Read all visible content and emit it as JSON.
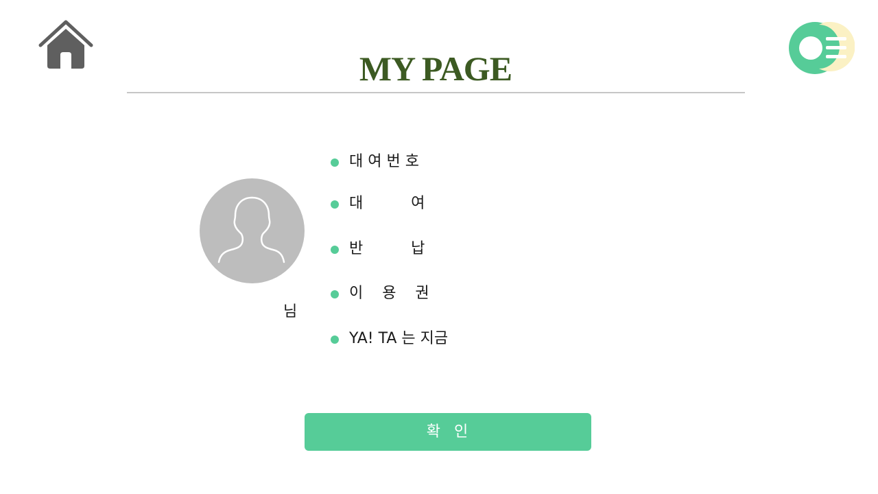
{
  "header": {
    "title": "MY PAGE",
    "title_color": "#3c5a22",
    "home_icon": "home-icon",
    "logo_icon": "app-logo"
  },
  "profile": {
    "avatar_icon": "user-silhouette-icon",
    "name_suffix": "님"
  },
  "info": {
    "items": [
      {
        "label": "대 여 번 호"
      },
      {
        "label": "대          여"
      },
      {
        "label": "반          납"
      },
      {
        "label": "이    용    권"
      },
      {
        "label": "YA! TA 는 지금"
      }
    ]
  },
  "actions": {
    "confirm_label": "확  인"
  },
  "colors": {
    "accent": "#56cc98",
    "icon_gray": "#5f5f5f",
    "avatar_bg": "#bdbdbd",
    "logo_cream": "#fbf1c4",
    "divider": "#c6c6c6"
  }
}
